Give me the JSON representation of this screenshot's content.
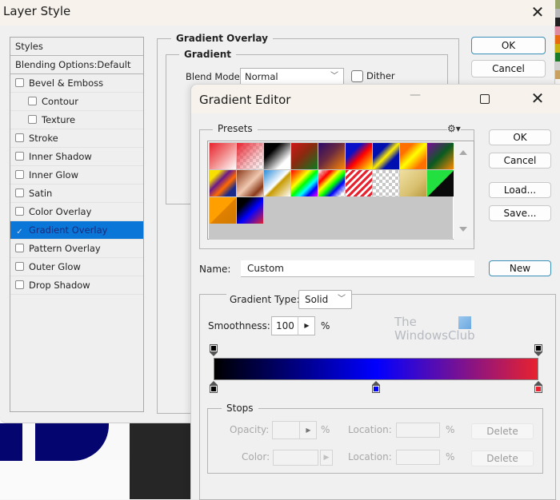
{
  "layer_style": {
    "title": "Layer Style",
    "close_icon": "close-icon",
    "styles_header": "Styles",
    "blending_options": "Blending Options:Default",
    "items": [
      {
        "label": "Bevel & Emboss",
        "checked": false,
        "sub": false,
        "selected": false
      },
      {
        "label": "Contour",
        "checked": false,
        "sub": true,
        "selected": false
      },
      {
        "label": "Texture",
        "checked": false,
        "sub": true,
        "selected": false
      },
      {
        "label": "Stroke",
        "checked": false,
        "sub": false,
        "selected": false
      },
      {
        "label": "Inner Shadow",
        "checked": false,
        "sub": false,
        "selected": false
      },
      {
        "label": "Inner Glow",
        "checked": false,
        "sub": false,
        "selected": false
      },
      {
        "label": "Satin",
        "checked": false,
        "sub": false,
        "selected": false
      },
      {
        "label": "Color Overlay",
        "checked": false,
        "sub": false,
        "selected": false
      },
      {
        "label": "Gradient Overlay",
        "checked": true,
        "sub": false,
        "selected": true
      },
      {
        "label": "Pattern Overlay",
        "checked": false,
        "sub": false,
        "selected": false
      },
      {
        "label": "Outer Glow",
        "checked": false,
        "sub": false,
        "selected": false
      },
      {
        "label": "Drop Shadow",
        "checked": false,
        "sub": false,
        "selected": false
      }
    ],
    "section_title": "Gradient Overlay",
    "group_title": "Gradient",
    "blend_mode_label": "Blend Mode:",
    "blend_mode_value": "Normal",
    "dither_label": "Dither",
    "dither_checked": false,
    "ok_label": "OK",
    "cancel_label": "Cancel",
    "selected_color": "#0a76d8"
  },
  "gradient_editor": {
    "title": "Gradient Editor",
    "presets_label": "Presets",
    "presets": [
      "linear-gradient(135deg,#e8222e 0%,#f08080 45%,#ffffff 100%)",
      "linear-gradient(135deg,#e8222e 0%,rgba(232,34,46,0.3) 60%,rgba(255,255,255,0) 100%), repeating-conic-gradient(#ddd 0 25%,#fff 0 50%) 0 0/8px 8px",
      "linear-gradient(135deg,#000 0%,#000 30%,#fff 75%,#fff 100%)",
      "linear-gradient(135deg,#d01818 0%,#8a2a10 45%,#0a7a20 100%)",
      "linear-gradient(135deg,#2a0a6a 0%,#6a2a40 45%,#ff8800 100%)",
      "linear-gradient(135deg,#0a10c8 0%,#0a10c8 30%,#ff0000 55%,#ffff00 100%)",
      "linear-gradient(135deg,#0010b0 0%,#0010b0 30%,#ffee00 50%,#0010b0 70%,#0010b0 100%)",
      "linear-gradient(135deg,#ff7000 0%,#ff7000 25%,#ffff00 50%,#ff7000 80%)",
      "linear-gradient(135deg,#7a0a9a 0%,#0a5a20 50%,#ff8800 100%)",
      "linear-gradient(135deg,#f8e000 0%,#f8e000 20%,#6a1a8a 40%,#ff6a00 60%,#1a2a8a 80%)",
      "linear-gradient(135deg,#8a3a1a 0%,#f0c8b0 50%,#8a3a1a 80%,#f0d8c8 100%)",
      "linear-gradient(135deg,#2a8ad8 0%,#ffffff 48%,#c89a00 55%,#ffffff 100%)",
      "linear-gradient(135deg,#ff0000 0%,#ff8800 20%,#ffff00 35%,#00ff00 50%,#00ffff 65%,#0000ff 80%,#ff00ff 100%)",
      "linear-gradient(135deg,rgba(255,255,255,0) 0%,#ff0000 25%,#ffff00 40%,#00ff00 55%,#0000ff 70%,rgba(255,255,255,0) 90%), repeating-conic-gradient(#ddd 0 25%,#fff 0 50%) 0 0/8px 8px",
      "repeating-linear-gradient(135deg,#e8222e 0px,#e8222e 3px,#ffffff 3px,#ffffff 6px)",
      "repeating-conic-gradient(#c8c8c8 0 25%,#fff 0 50%) 0 0/8px 8px",
      "linear-gradient(135deg,#f0e0a0 0%,#d8c070 60%,#b89a40 100%)",
      "linear-gradient(135deg,#22e040 0%,#22e040 50%,#0a0a0a 52%,#0a0a0a 100%)",
      "linear-gradient(135deg,#ffa000 0%,#ffa000 50%,#e08000 52%,#d07a00 100%)",
      "linear-gradient(135deg,#000000 0%,#000000 25%,#0000ff 55%,#e8222e 100%)"
    ],
    "preset_names": [
      "preset-red-white",
      "preset-red-transparent",
      "preset-black-white",
      "preset-red-green",
      "preset-violet-orange",
      "preset-blue-red-yellow",
      "preset-blue-yellow-blue",
      "preset-orange-yellow-orange",
      "preset-violet-green-orange",
      "preset-yellow-violet-orange-blue",
      "preset-copper",
      "preset-chrome",
      "preset-spectrum",
      "preset-transparent-rainbow",
      "preset-transparent-stripes",
      "preset-transparent",
      "preset-gold",
      "preset-green-black",
      "preset-orange",
      "preset-black-blue-red"
    ],
    "gear_icon": "gear-icon",
    "ok_label": "OK",
    "cancel_label": "Cancel",
    "load_label": "Load...",
    "save_label": "Save...",
    "name_label": "Name:",
    "name_value": "Custom",
    "new_label": "New",
    "gradient_type_label": "Gradient Type:",
    "gradient_type_value": "Solid",
    "smoothness_label": "Smoothness:",
    "smoothness_value": "100",
    "smoothness_unit": "%",
    "watermark_line1": "The",
    "watermark_line2": "WindowsClub",
    "gradient": {
      "color_stops": [
        {
          "color": "#000000",
          "location": 0
        },
        {
          "color": "#0000ff",
          "location": 50
        },
        {
          "color": "#e8222e",
          "location": 100
        }
      ],
      "opacity_stops": [
        {
          "opacity": 100,
          "location": 0
        },
        {
          "opacity": 100,
          "location": 100
        }
      ]
    },
    "stops": {
      "title": "Stops",
      "opacity_label": "Opacity:",
      "opacity_value": "",
      "opacity_unit": "%",
      "opacity_location_label": "Location:",
      "opacity_location_value": "",
      "opacity_location_unit": "%",
      "opacity_delete_label": "Delete",
      "color_label": "Color:",
      "color_location_label": "Location:",
      "color_location_value": "",
      "color_location_unit": "%",
      "color_delete_label": "Delete"
    }
  },
  "background": {
    "swatches": [
      "#9aa56a",
      "#b8b8b8",
      "#202020",
      "#e08aa0",
      "#e86a10",
      "#c8b010",
      "#1a7a2a",
      "#d0d0d0",
      "#c8a060"
    ]
  }
}
